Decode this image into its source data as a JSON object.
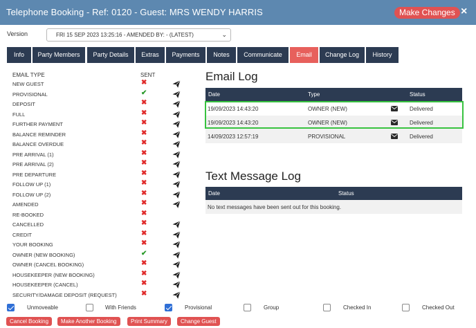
{
  "window": {
    "title": "Telephone Booking - Ref: 0120 - Guest: MRS WENDY HARRIS",
    "make_changes": "Make Changes",
    "close": "×"
  },
  "version": {
    "label": "Version",
    "selected": "FRI 15 SEP 2023 13:25:16 - AMENDED BY: - (LATEST)"
  },
  "tabs": [
    {
      "label": "Info"
    },
    {
      "label": "Party Members"
    },
    {
      "label": "Party Details"
    },
    {
      "label": "Extras"
    },
    {
      "label": "Payments"
    },
    {
      "label": "Notes"
    },
    {
      "label": "Communicate"
    },
    {
      "label": "Email",
      "active": true
    },
    {
      "label": "Change Log"
    },
    {
      "label": "History"
    }
  ],
  "email_types": {
    "header_type": "EMAIL TYPE",
    "header_sent": "SENT",
    "rows": [
      {
        "name": "NEW GUEST",
        "sent": false,
        "can_send": true
      },
      {
        "name": "PROVISIONAL",
        "sent": true,
        "can_send": true
      },
      {
        "name": "DEPOSIT",
        "sent": false,
        "can_send": true
      },
      {
        "name": "FULL",
        "sent": false,
        "can_send": true
      },
      {
        "name": "FURTHER PAYMENT",
        "sent": false,
        "can_send": true
      },
      {
        "name": "BALANCE REMINDER",
        "sent": false,
        "can_send": true
      },
      {
        "name": "BALANCE OVERDUE",
        "sent": false,
        "can_send": true
      },
      {
        "name": "PRE ARRIVAL (1)",
        "sent": false,
        "can_send": true
      },
      {
        "name": "PRE ARRIVAL (2)",
        "sent": false,
        "can_send": true
      },
      {
        "name": "PRE DEPARTURE",
        "sent": false,
        "can_send": true
      },
      {
        "name": "FOLLOW UP (1)",
        "sent": false,
        "can_send": true
      },
      {
        "name": "FOLLOW UP (2)",
        "sent": false,
        "can_send": true
      },
      {
        "name": "AMENDED",
        "sent": false,
        "can_send": true
      },
      {
        "name": "RE-BOOKED",
        "sent": false,
        "can_send": false
      },
      {
        "name": "CANCELLED",
        "sent": false,
        "can_send": true
      },
      {
        "name": "CREDIT",
        "sent": false,
        "can_send": true
      },
      {
        "name": "YOUR BOOKING",
        "sent": false,
        "can_send": true
      },
      {
        "name": "OWNER (NEW BOOKING)",
        "sent": true,
        "can_send": true
      },
      {
        "name": "OWNER (CANCEL BOOKING)",
        "sent": false,
        "can_send": true
      },
      {
        "name": "HOUSEKEEPER (NEW BOOKING)",
        "sent": false,
        "can_send": true
      },
      {
        "name": "HOUSEKEEPER (CANCEL)",
        "sent": false,
        "can_send": true
      },
      {
        "name": "SECURITY/DAMAGE DEPOSIT (REQUEST)",
        "sent": false,
        "can_send": true
      }
    ]
  },
  "email_log": {
    "title": "Email Log",
    "columns": {
      "date": "Date",
      "type": "Type",
      "status": "Status"
    },
    "rows": [
      {
        "date": "19/09/2023 14:43:20",
        "type": "OWNER (NEW)",
        "status": "Delivered"
      },
      {
        "date": "19/09/2023 14:43:20",
        "type": "OWNER (NEW)",
        "status": "Delivered"
      },
      {
        "date": "14/09/2023 12:57:19",
        "type": "PROVISIONAL",
        "status": "Delivered"
      }
    ]
  },
  "text_log": {
    "title": "Text Message Log",
    "columns": {
      "date": "Date",
      "status": "Status"
    },
    "empty": "No text messages have been sent out for this booking."
  },
  "flags": [
    {
      "label": "Unmoveable",
      "checked": true
    },
    {
      "label": "With Friends",
      "checked": false
    },
    {
      "label": "Provisional",
      "checked": true
    },
    {
      "label": "Group",
      "checked": false
    },
    {
      "label": "Checked In",
      "checked": false
    },
    {
      "label": "Checked Out",
      "checked": false
    }
  ],
  "actions": {
    "cancel_booking": "Cancel Booking",
    "make_another": "Make Another Booking",
    "print_summary": "Print Summary",
    "change_guest": "Change Guest"
  },
  "colors": {
    "titlebar": "#5d88b0",
    "tab": "#2c3b52",
    "tab_active": "#e7605c",
    "button": "#e05252",
    "highlight": "#37c23f"
  },
  "icons": {
    "send": "paper-plane-icon",
    "envelope": "envelope-icon",
    "sent_yes": "check-icon",
    "sent_no": "cross-icon"
  }
}
